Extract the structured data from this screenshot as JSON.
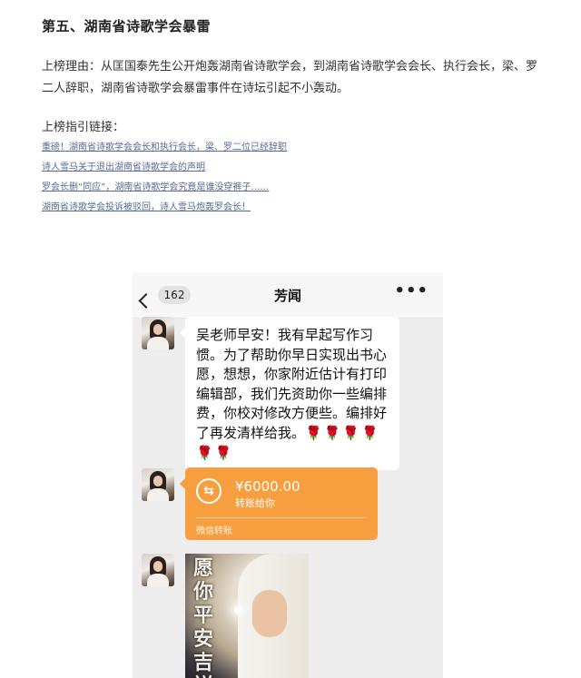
{
  "article": {
    "heading": "第五、湖南省诗歌学会暴雷",
    "reason": "上榜理由：从匡国泰先生公开炮轰湖南省诗歌学会，到湖南省诗歌学会会长、执行会长，梁、罗二人辞职，湖南省诗歌学会暴雷事件在诗坛引起不小轰动。",
    "links_title": "上榜指引链接：",
    "links": [
      "重磅！湖南省诗歌学会会长和执行会长，梁、罗二位已经辞职",
      "诗人雪马关于退出湖南省诗歌学会的声明",
      "罗会长删“同应”，湖南省诗歌学会究竟是谁没穿裤子……",
      "湖南省诗歌学会投诉被驳回，诗人雪马炮轰罗会长！"
    ]
  },
  "chat": {
    "back_count": "162",
    "title": "芳闻",
    "more_icon": "ellipsis-icon",
    "message_text": "吴老师早安！我有早起写作习惯。为了帮助你早日实现出书心愿，想想，你家附近估计有打印编辑部，我们先资助你一些编排费，你校对修改方便些。编排好了再发清样给我。",
    "roses": "🌹🌹🌹🌹🌹🌹",
    "transfer": {
      "amount": "¥6000.00",
      "label": "转账给你",
      "footer": "微信转账",
      "color": "#f79e3f"
    },
    "image_caption": "愿你平安吉祥"
  }
}
